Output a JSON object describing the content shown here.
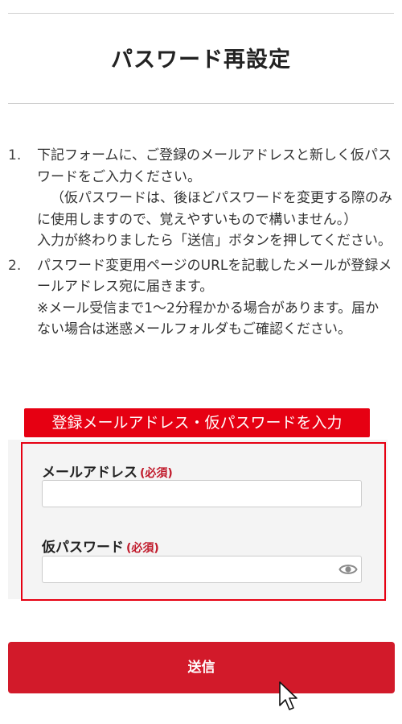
{
  "page": {
    "title": "パスワード再設定"
  },
  "instructions": [
    {
      "number": "1.",
      "lines": [
        {
          "text": "下記フォームに、ご登録のメールアドレスと新しく仮パスワードをご入力ください。",
          "indent": false
        },
        {
          "text": "（仮パスワードは、後ほどパスワードを変更する際のみに使用しますので、覚えやすいもので構いません。）",
          "indent": true
        },
        {
          "text": "入力が終わりましたら「送信」ボタンを押してください。",
          "indent": false
        }
      ]
    },
    {
      "number": "2.",
      "lines": [
        {
          "text": "パスワード変更用ページのURLを記載したメールが登録メールアドレス宛に届きます。",
          "indent": false
        },
        {
          "text": "※メール受信まで1〜2分程かかる場合があります。届かない場合は迷惑メールフォルダもご確認ください。",
          "indent": false
        }
      ]
    }
  ],
  "annotation": {
    "banner_text": "登録メールアドレス・仮パスワードを入力",
    "color": "#e60012"
  },
  "form": {
    "email": {
      "label": "メールアドレス",
      "required": "(必須)",
      "value": ""
    },
    "temp_password": {
      "label": "仮パスワード",
      "required": "(必須)",
      "value": "",
      "toggle_icon": "eye-icon"
    }
  },
  "submit": {
    "label": "送信",
    "color": "#d21a2a"
  }
}
